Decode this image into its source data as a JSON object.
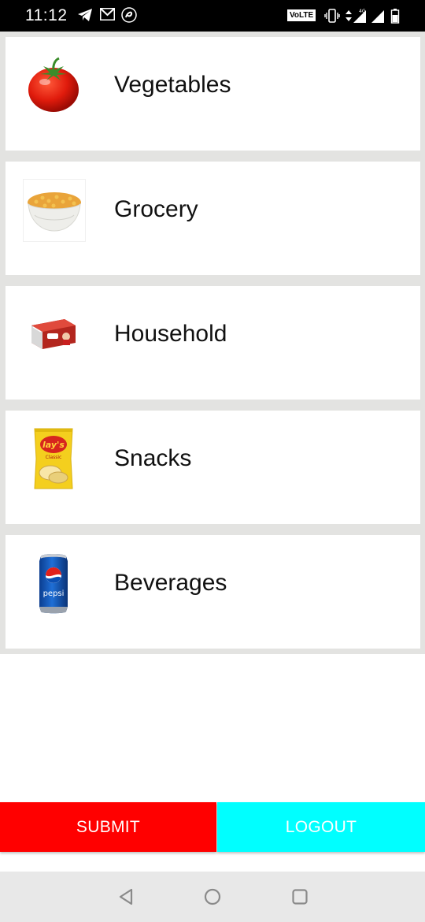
{
  "status_bar": {
    "time": "11:12",
    "volte": "VoLTE",
    "icons": [
      "telegram-icon",
      "gmail-icon",
      "airtel-icon",
      "vibrate-icon",
      "data-arrows-icon",
      "signal-4g-icon",
      "signal-icon",
      "battery-icon"
    ]
  },
  "categories": [
    {
      "label": "Vegetables",
      "icon": "tomato-icon"
    },
    {
      "label": "Grocery",
      "icon": "lentils-bowl-icon"
    },
    {
      "label": "Household",
      "icon": "soap-box-icon"
    },
    {
      "label": "Snacks",
      "icon": "chips-packet-icon"
    },
    {
      "label": "Beverages",
      "icon": "soda-can-icon"
    }
  ],
  "buttons": {
    "submit": "SUBMIT",
    "logout": "LOGOUT"
  },
  "colors": {
    "submit_bg": "#ff0000",
    "logout_bg": "#00ffff",
    "list_bg": "#e3e3e1"
  },
  "nav": [
    "back-icon",
    "home-icon",
    "recents-icon"
  ]
}
